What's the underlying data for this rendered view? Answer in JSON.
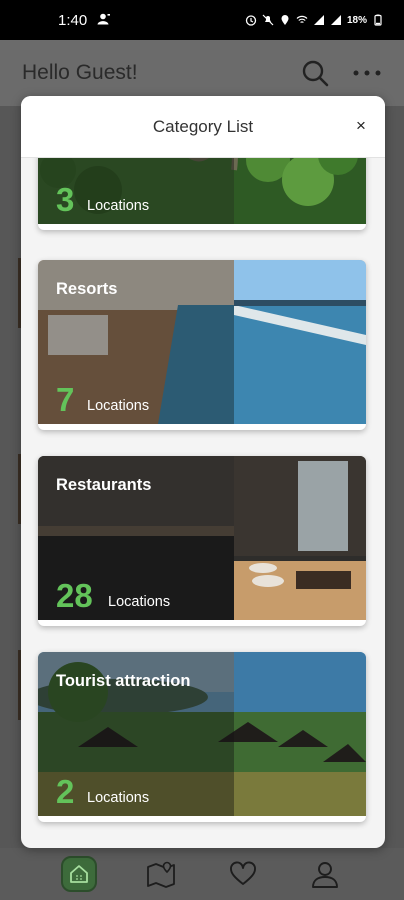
{
  "status_bar": {
    "time": "1:40",
    "battery": "18%"
  },
  "app_bar": {
    "greeting": "Hello Guest!"
  },
  "modal": {
    "title": "Category List",
    "close_label": "×",
    "categories": [
      {
        "name": "",
        "count": "3",
        "locations_label": "Locations"
      },
      {
        "name": "Resorts",
        "count": "7",
        "locations_label": "Locations"
      },
      {
        "name": "Restaurants",
        "count": "28",
        "locations_label": "Locations"
      },
      {
        "name": "Tourist attraction",
        "count": "2",
        "locations_label": "Locations"
      }
    ]
  },
  "colors": {
    "accent_green": "#63c35a",
    "nav_home_bg": "#3d6b3b"
  },
  "icons": {
    "app_bar": [
      "search-icon",
      "more-icon"
    ],
    "bottom_nav": [
      "home-icon",
      "map-icon",
      "heart-icon",
      "profile-icon"
    ]
  }
}
